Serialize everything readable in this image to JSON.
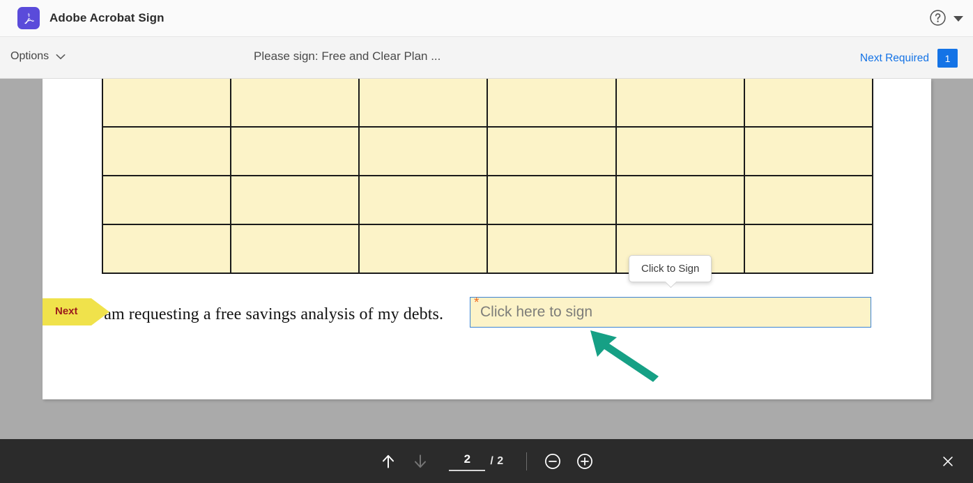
{
  "app": {
    "title": "Adobe Acrobat Sign",
    "logo_icon": "adobe-acrobat-logo",
    "help_icon": "help-circle-icon",
    "caret_icon": "caret-down-icon"
  },
  "subbar": {
    "options_label": "Options",
    "options_chevron_icon": "chevron-down-icon",
    "document_title": "Please sign: Free and Clear Plan ...",
    "next_required_label": "Next Required",
    "next_required_count": "1",
    "accent_blue": "#1473e6"
  },
  "document": {
    "sentence": "I am requesting a free savings analysis of my debts.",
    "table": {
      "rows": 4,
      "columns": 6,
      "cells": [
        [
          "",
          "",
          "",
          "",
          "",
          ""
        ],
        [
          "",
          "",
          "",
          "",
          "",
          ""
        ],
        [
          "",
          "",
          "",
          "",
          "",
          ""
        ],
        [
          "",
          "",
          "",
          "",
          "",
          ""
        ]
      ],
      "cell_fill": "#fcf3c8",
      "border_color": "#1a1a1a"
    }
  },
  "signature_field": {
    "placeholder": "Click here to sign",
    "required_marker": "*",
    "required_color": "#f06c23",
    "border_color": "#3b83d4",
    "fill_color": "#fcf3c8"
  },
  "tooltip": {
    "text": "Click to Sign"
  },
  "next_flag": {
    "label": "Next",
    "fill_color": "#f0e24b",
    "text_color": "#9b1b1b"
  },
  "pointer": {
    "icon": "arrow-up-left-icon",
    "color": "#16a085"
  },
  "bottom_toolbar": {
    "prev_page_icon": "arrow-up-icon",
    "next_page_icon": "arrow-down-icon",
    "page_current": "2",
    "page_total": "/ 2",
    "zoom_out_icon": "minus-circle-icon",
    "zoom_in_icon": "plus-circle-icon",
    "close_icon": "close-icon",
    "background": "#2b2b2b"
  }
}
